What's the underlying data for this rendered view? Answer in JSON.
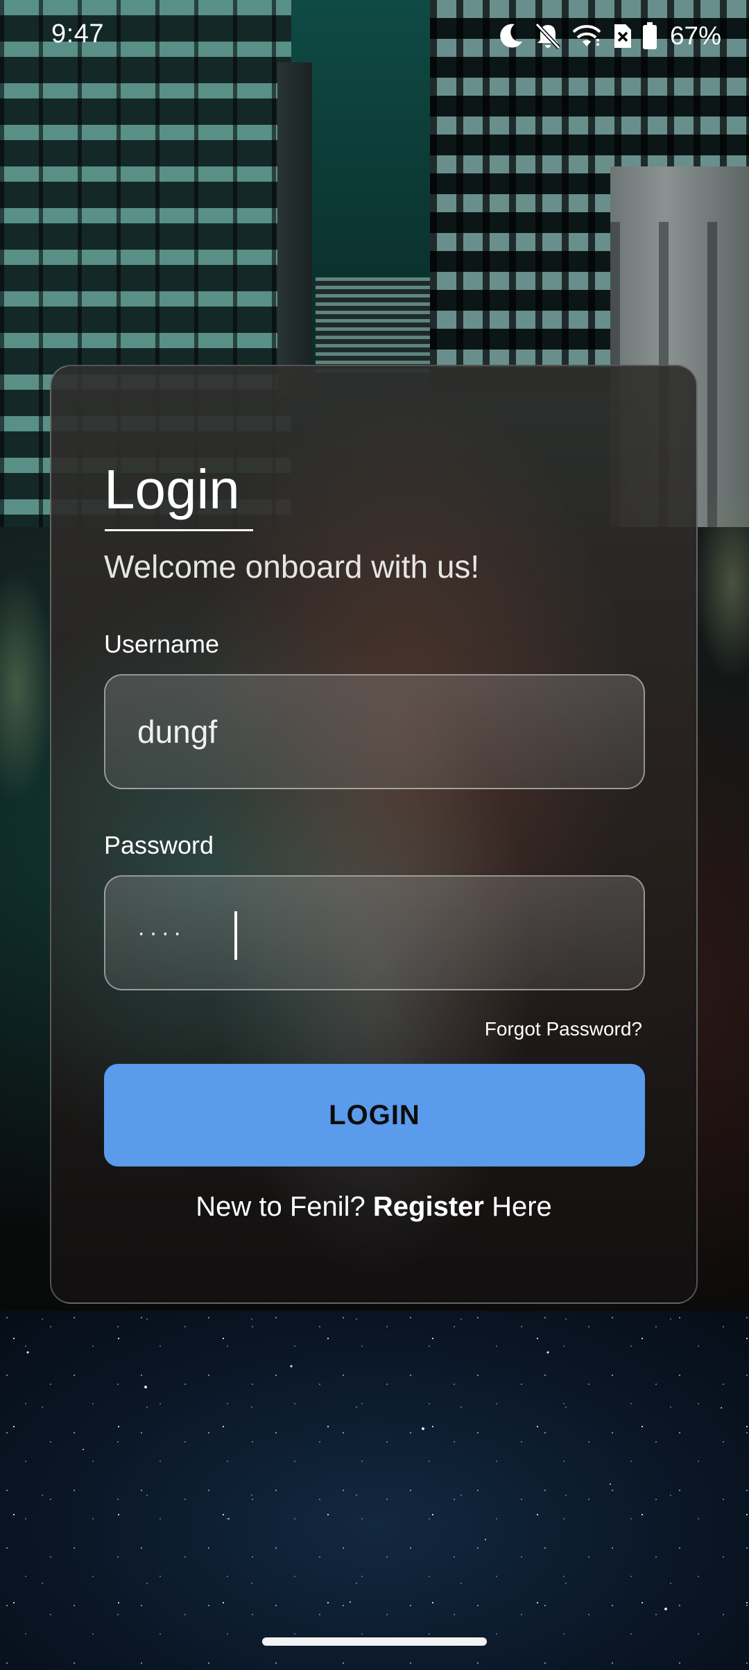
{
  "status_bar": {
    "time": "9:47",
    "icons": [
      "moon-icon",
      "bell-off-icon",
      "wifi-icon",
      "sim-x-icon",
      "battery-icon"
    ],
    "battery_percent": "67%"
  },
  "login": {
    "title": "Login",
    "subtitle": "Welcome onboard with us!",
    "username_label": "Username",
    "username_value": "dungf",
    "password_label": "Password",
    "password_value": "····",
    "forgot_password": "Forgot Password?",
    "login_button": "LOGIN",
    "register_prefix": "New to Fenil? ",
    "register_link": "Register",
    "register_suffix": " Here"
  },
  "colors": {
    "button_accent": "#5a9bec",
    "text": "#ffffff"
  }
}
